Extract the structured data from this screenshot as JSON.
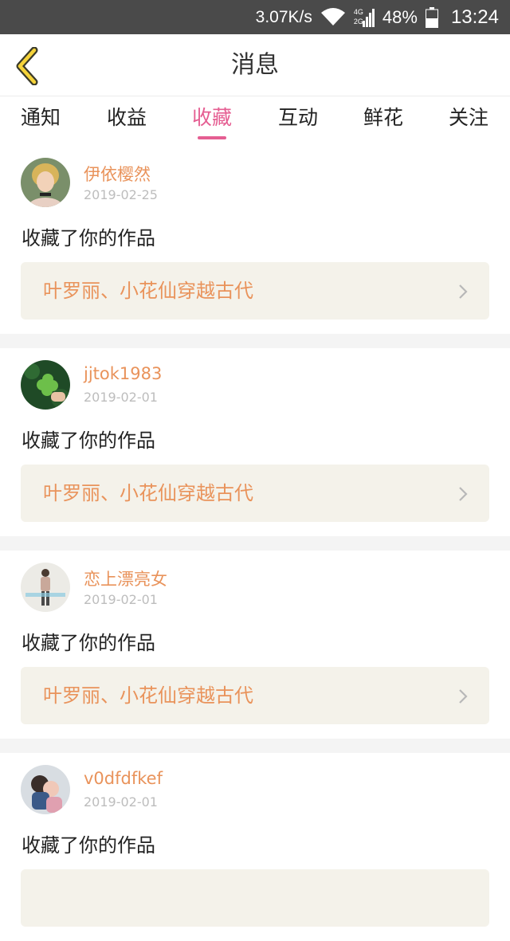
{
  "status_bar": {
    "speed": "3.07K/s",
    "network_top": "4G",
    "network_bottom": "2G",
    "battery": "48%",
    "time": "13:24"
  },
  "header": {
    "title": "消息",
    "back_icon": "chevron-left-icon"
  },
  "tabs": [
    {
      "label": "通知",
      "active": false
    },
    {
      "label": "收益",
      "active": false
    },
    {
      "label": "收藏",
      "active": true
    },
    {
      "label": "互动",
      "active": false
    },
    {
      "label": "鲜花",
      "active": false
    },
    {
      "label": "关注",
      "active": false
    }
  ],
  "colors": {
    "accent_pink": "#e55e92",
    "name_orange": "#e9935b",
    "box_bg": "#f4f2ea"
  },
  "messages": [
    {
      "username": "伊依樱然",
      "date": "2019-02-25",
      "action": "收藏了你的作品",
      "work": "叶罗丽、小花仙穿越古代"
    },
    {
      "username": "jjtok1983",
      "date": "2019-02-01",
      "action": "收藏了你的作品",
      "work": "叶罗丽、小花仙穿越古代"
    },
    {
      "username": "恋上漂亮女",
      "date": "2019-02-01",
      "action": "收藏了你的作品",
      "work": "叶罗丽、小花仙穿越古代"
    },
    {
      "username": "v0dfdfkef",
      "date": "2019-02-01",
      "action": "收藏了你的作品",
      "work": ""
    }
  ]
}
